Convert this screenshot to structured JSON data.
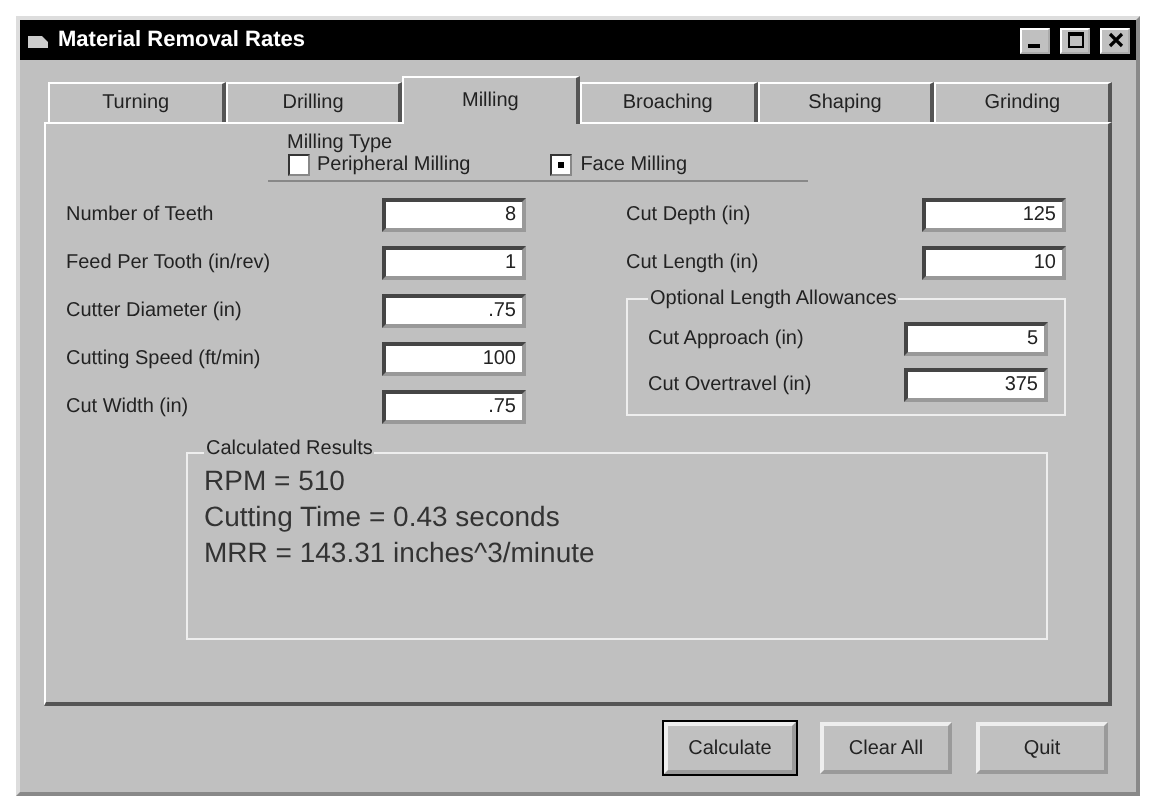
{
  "window": {
    "title": "Material Removal Rates"
  },
  "tabs": [
    {
      "label": "Turning",
      "selected": false
    },
    {
      "label": "Drilling",
      "selected": false
    },
    {
      "label": "Milling",
      "selected": true
    },
    {
      "label": "Broaching",
      "selected": false
    },
    {
      "label": "Shaping",
      "selected": false
    },
    {
      "label": "Grinding",
      "selected": false
    }
  ],
  "milling_type": {
    "label": "Milling Type",
    "options": [
      {
        "label": "Peripheral Milling",
        "selected": false
      },
      {
        "label": "Face Milling",
        "selected": true
      }
    ]
  },
  "left_fields": [
    {
      "label": "Number of Teeth",
      "value": "8"
    },
    {
      "label": "Feed Per Tooth (in/rev)",
      "value": "1"
    },
    {
      "label": "Cutter Diameter  (in)",
      "value": ".75"
    },
    {
      "label": "Cutting Speed (ft/min)",
      "value": "100"
    },
    {
      "label": "Cut Width (in)",
      "value": ".75"
    }
  ],
  "right_fields": [
    {
      "label": "Cut Depth (in)",
      "value": "125"
    },
    {
      "label": "Cut Length (in)",
      "value": "10"
    }
  ],
  "allowances": {
    "label": "Optional Length Allowances",
    "fields": [
      {
        "label": "Cut Approach  (in)",
        "value": "5"
      },
      {
        "label": "Cut Overtravel (in)",
        "value": "375"
      }
    ]
  },
  "results": {
    "label": "Calculated Results",
    "lines": [
      "RPM = 510",
      "Cutting Time = 0.43 seconds",
      "MRR = 143.31 inches^3/minute"
    ]
  },
  "buttons": [
    {
      "label": "Calculate",
      "selected": true
    },
    {
      "label": "Clear All",
      "selected": false
    },
    {
      "label": "Quit",
      "selected": false
    }
  ]
}
